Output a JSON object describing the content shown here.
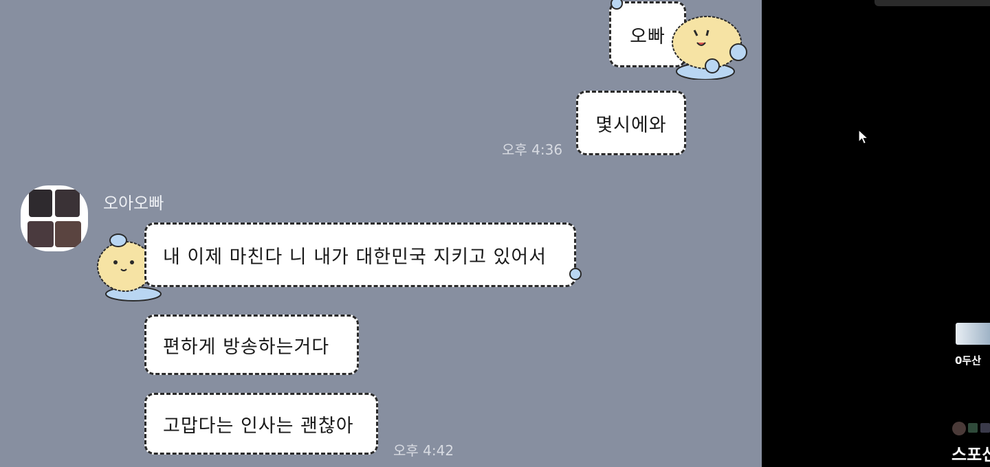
{
  "chat": {
    "sent_messages": [
      {
        "text": "오빠"
      },
      {
        "text": "몇시에와",
        "time": "오후 4:36"
      }
    ],
    "sender_name": "오아오빠",
    "received_messages": [
      {
        "text": "내 이제 마친다 니 내가 대한민국 지키고 있어서"
      },
      {
        "text": "편하게 방송하는거다"
      },
      {
        "text": "고맙다는 인사는 괜찮아",
        "time": "오후 4:42"
      }
    ]
  },
  "side": {
    "mini_label": "0두산",
    "bottom_label": "스포신"
  },
  "colors": {
    "chat_bg": "#878fa0",
    "bubble_bg": "#ffffff",
    "mascot": "#f6e3a4",
    "mascot_accent": "#b9d6f2"
  },
  "icons": [
    "mouse-cursor-icon",
    "bear-mascot-icon"
  ]
}
